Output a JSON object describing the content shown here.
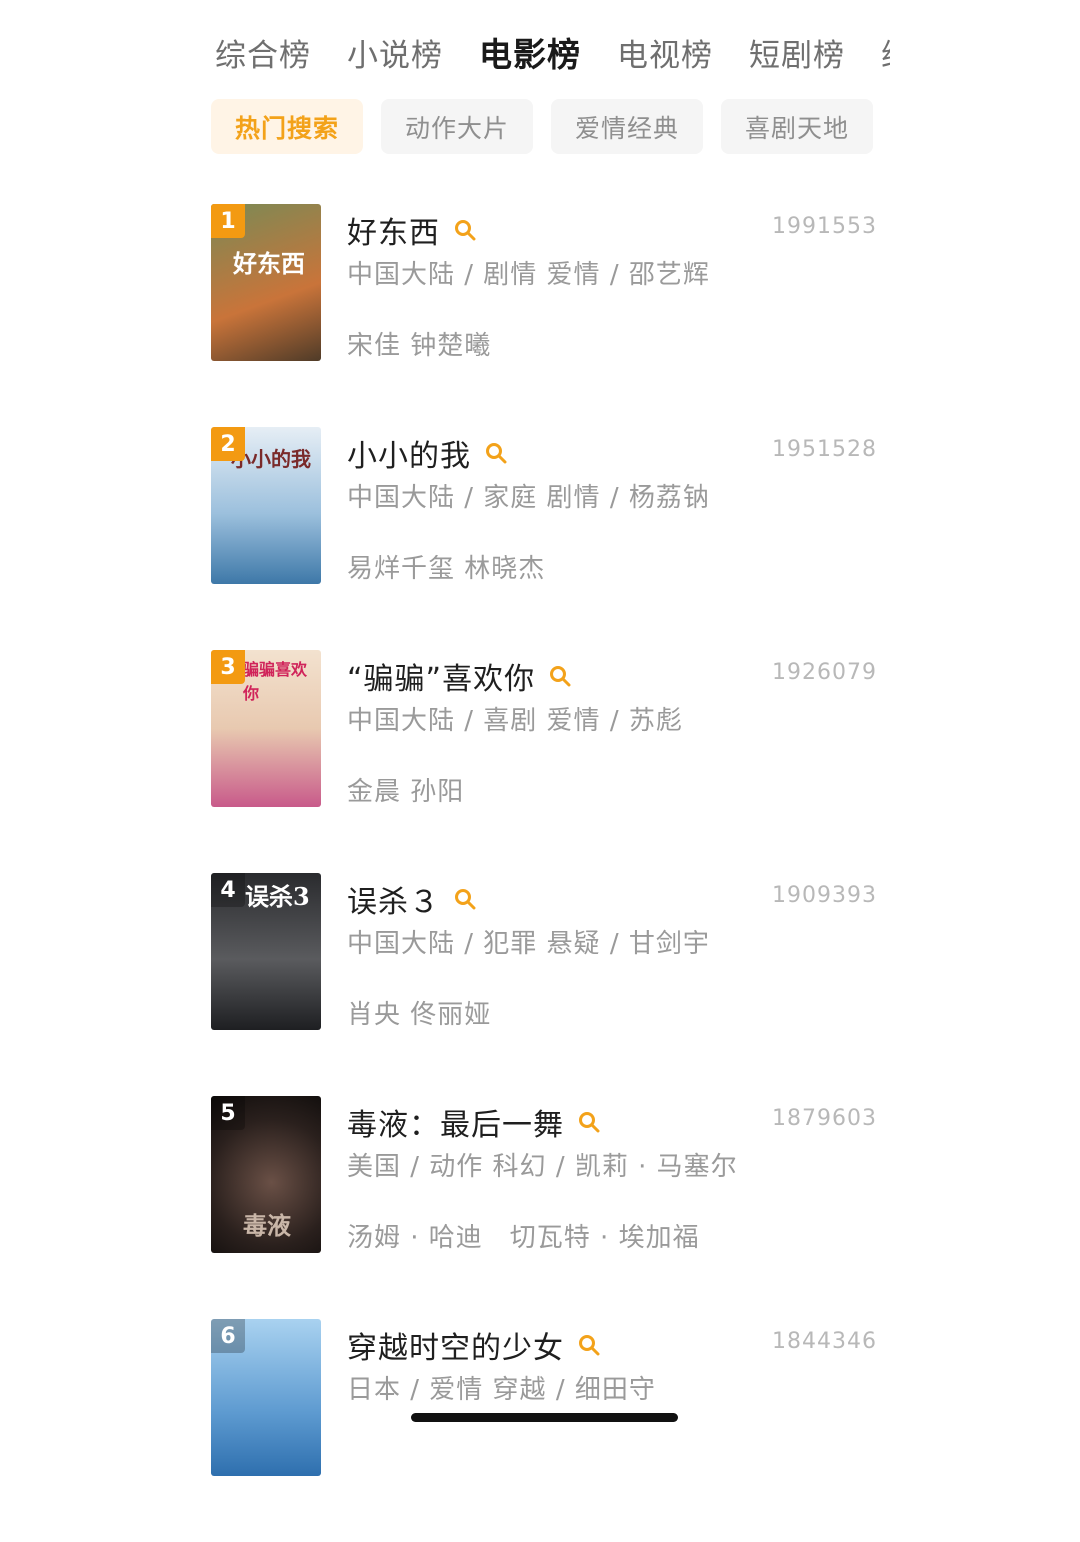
{
  "tabs": [
    "综合榜",
    "小说榜",
    "电影榜",
    "电视榜",
    "短剧榜",
    "综艺榜"
  ],
  "active_tab_index": 2,
  "subtabs": [
    "热门搜索",
    "动作大片",
    "爱情经典",
    "喜剧天地"
  ],
  "active_subtab_index": 0,
  "items": [
    {
      "rank": "1",
      "title": "好东西",
      "meta": "中国大陆 / 剧情 爱情 / 邵艺辉",
      "actors": "宋佳 钟楚曦",
      "count": "1991553",
      "poster_text": "好东西",
      "poster_colors": [
        "#7a8a55",
        "#c9743a"
      ]
    },
    {
      "rank": "2",
      "title": "小小的我",
      "meta": "中国大陆 / 家庭 剧情 / 杨荔钠",
      "actors": "易烊千玺 林晓杰",
      "count": "1951528",
      "poster_text": "小小的我",
      "poster_colors": [
        "#cfe3f2",
        "#4f86b8"
      ]
    },
    {
      "rank": "3",
      "title": "“骗骗”喜欢你",
      "meta": "中国大陆 / 喜剧 爱情 / 苏彪",
      "actors": "金晨 孙阳",
      "count": "1926079",
      "poster_text": "骗骗喜欢你",
      "poster_colors": [
        "#f3e2cf",
        "#c85a8a"
      ]
    },
    {
      "rank": "4",
      "title": "误杀３",
      "meta": "中国大陆 / 犯罪 悬疑 / 甘剑宇",
      "actors": "肖央 佟丽娅",
      "count": "1909393",
      "poster_text": "误杀3",
      "poster_colors": [
        "#4a4b4e",
        "#1e1f22"
      ]
    },
    {
      "rank": "5",
      "title": "毒液：最后一舞",
      "meta": "美国 / 动作 科幻 / 凯莉 · 马塞尔",
      "actors": "汤姆 · 哈迪　切瓦特 · 埃加福",
      "count": "1879603",
      "poster_text": "毒液",
      "poster_colors": [
        "#3a2f2c",
        "#151212"
      ]
    },
    {
      "rank": "6",
      "title": "穿越时空的少女",
      "meta": "日本 / 爱情 穿越 / 细田守",
      "actors": "",
      "count": "1844346",
      "poster_text": "",
      "poster_colors": [
        "#7fb6e4",
        "#2e6fae"
      ]
    }
  ],
  "icons": {
    "item_search": "search-icon"
  },
  "colors": {
    "accent": "#f3a21a",
    "rank_badge": "#f39a12"
  }
}
